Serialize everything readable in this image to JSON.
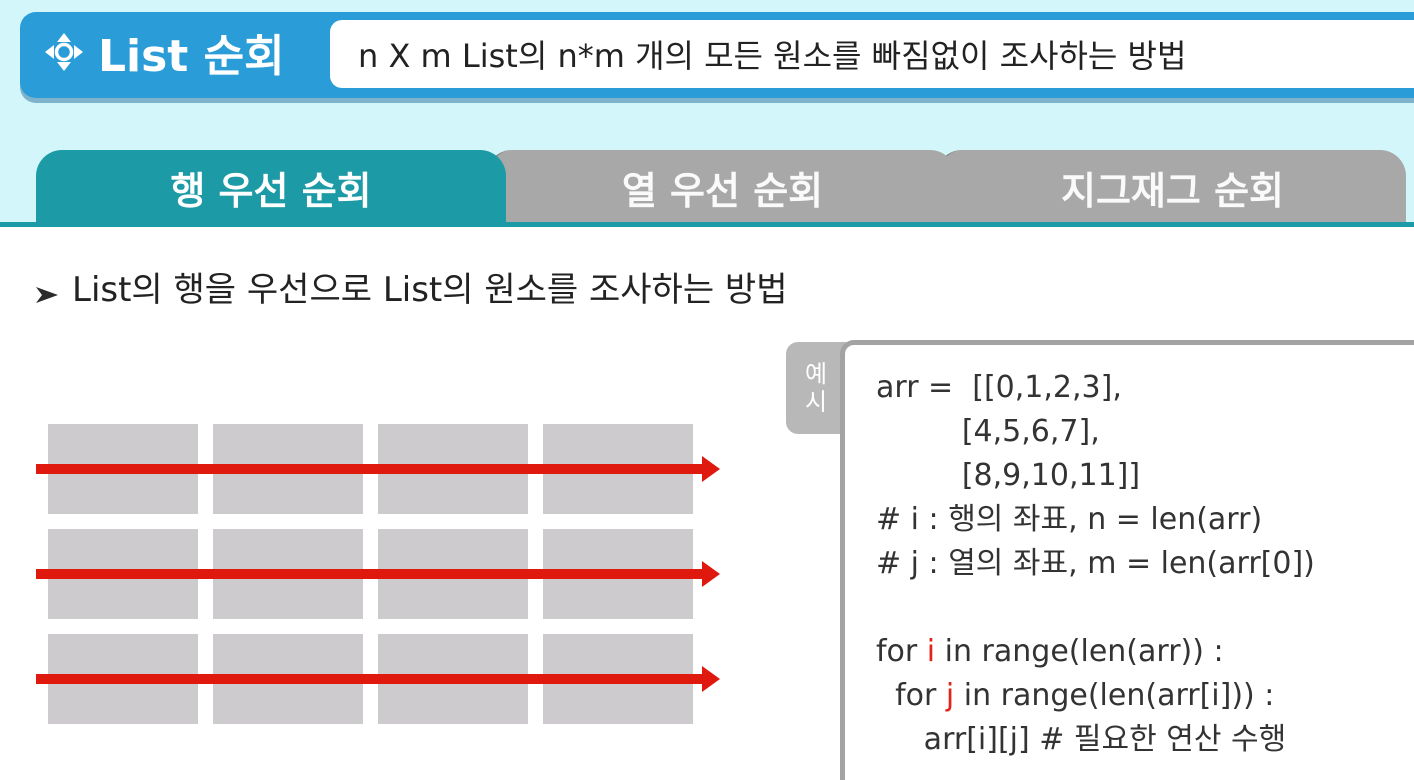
{
  "header": {
    "title": "List 순회",
    "description": "n X m List의 n*m 개의 모든 원소를 빠짐없이 조사하는 방법",
    "icon": "move-arrows-icon"
  },
  "tabs": [
    {
      "label": "행 우선 순회",
      "active": true
    },
    {
      "label": "열 우선 순회",
      "active": false
    },
    {
      "label": "지그재그 순회",
      "active": false
    }
  ],
  "subtitle": {
    "text": "List의 행을 우선으로 List의 원소를 조사하는 방법",
    "icon": "bullet-arrow-icon"
  },
  "diagram": {
    "rows": 3,
    "cols": 4,
    "arrow_direction": "left-to-right",
    "cell_color": "#cdcbcd",
    "arrow_color": "#e0190e"
  },
  "example": {
    "label_chars": [
      "예",
      "시"
    ],
    "code_lines": [
      {
        "parts": [
          {
            "t": "arr =  [[0,1,2,3],"
          }
        ]
      },
      {
        "parts": [
          {
            "t": "         [4,5,6,7],"
          }
        ]
      },
      {
        "parts": [
          {
            "t": "         [8,9,10,11]]"
          }
        ]
      },
      {
        "parts": [
          {
            "t": "# i : 행의 좌표, n = len(arr)"
          }
        ]
      },
      {
        "parts": [
          {
            "t": "# j : 열의 좌표, m = len(arr[0])"
          }
        ]
      },
      {
        "parts": [
          {
            "t": ""
          }
        ]
      },
      {
        "parts": [
          {
            "t": "for "
          },
          {
            "t": "i",
            "hl": true
          },
          {
            "t": " in range(len(arr)) :"
          }
        ]
      },
      {
        "parts": [
          {
            "t": "  for "
          },
          {
            "t": "j",
            "hl": true
          },
          {
            "t": " in range(len(arr[i])) :"
          }
        ]
      },
      {
        "parts": [
          {
            "t": "     arr[i][j] # 필요한 연산 수행"
          }
        ]
      }
    ]
  },
  "colors": {
    "header_blue": "#2a9cd8",
    "band_bg": "#d3f6fa",
    "active_tab": "#1c9aa5",
    "inactive_tab": "#a8a8a8",
    "highlight_red": "#e2231a"
  }
}
